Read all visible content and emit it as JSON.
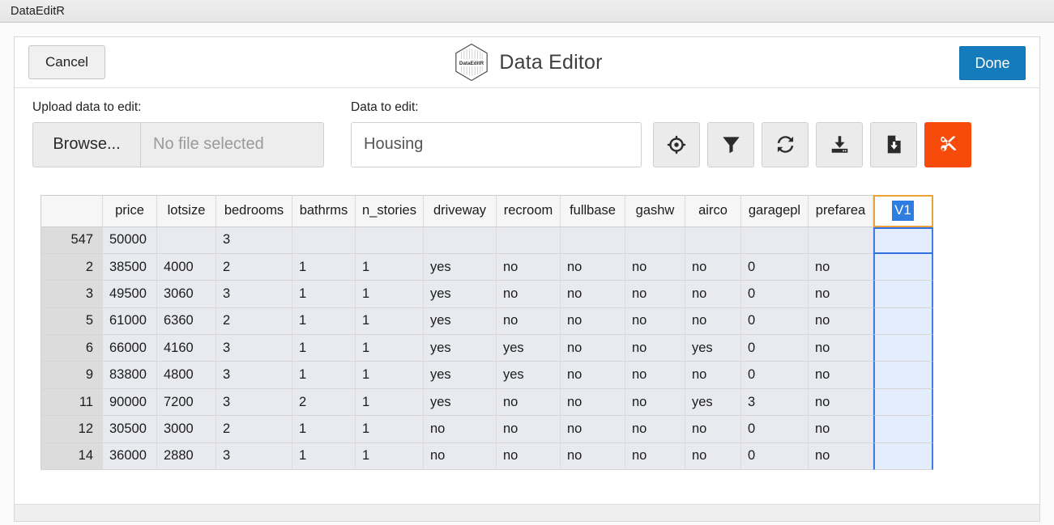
{
  "window": {
    "title": "DataEditR"
  },
  "header": {
    "cancel_label": "Cancel",
    "title": "Data Editor",
    "logo_text": "DataEditR",
    "done_label": "Done"
  },
  "controls": {
    "upload_label": "Upload data to edit:",
    "browse_label": "Browse...",
    "file_placeholder": "No file selected",
    "data_label": "Data to edit:",
    "data_value": "Housing",
    "tools": [
      {
        "name": "crosshairs-icon",
        "title": "select"
      },
      {
        "name": "filter-icon",
        "title": "filter"
      },
      {
        "name": "sync-icon",
        "title": "sync"
      },
      {
        "name": "download-icon",
        "title": "save"
      },
      {
        "name": "file-download-icon",
        "title": "export"
      },
      {
        "name": "scissors-icon",
        "title": "cut",
        "color": "#f74b0c"
      }
    ]
  },
  "table": {
    "columns": [
      "price",
      "lotsize",
      "bedrooms",
      "bathrms",
      "n_stories",
      "driveway",
      "recroom",
      "fullbase",
      "gashw",
      "airco",
      "garagepl",
      "prefarea"
    ],
    "editing_column": {
      "value": "V1",
      "selected": true
    },
    "rows": [
      {
        "id": "547",
        "cells": [
          "50000",
          "",
          "3",
          "",
          "",
          "",
          "",
          "",
          "",
          "",
          "",
          ""
        ],
        "extra": ""
      },
      {
        "id": "2",
        "cells": [
          "38500",
          "4000",
          "2",
          "1",
          "1",
          "yes",
          "no",
          "no",
          "no",
          "no",
          "0",
          "no"
        ],
        "extra": ""
      },
      {
        "id": "3",
        "cells": [
          "49500",
          "3060",
          "3",
          "1",
          "1",
          "yes",
          "no",
          "no",
          "no",
          "no",
          "0",
          "no"
        ],
        "extra": ""
      },
      {
        "id": "5",
        "cells": [
          "61000",
          "6360",
          "2",
          "1",
          "1",
          "yes",
          "no",
          "no",
          "no",
          "no",
          "0",
          "no"
        ],
        "extra": ""
      },
      {
        "id": "6",
        "cells": [
          "66000",
          "4160",
          "3",
          "1",
          "1",
          "yes",
          "yes",
          "no",
          "no",
          "yes",
          "0",
          "no"
        ],
        "extra": ""
      },
      {
        "id": "9",
        "cells": [
          "83800",
          "4800",
          "3",
          "1",
          "1",
          "yes",
          "yes",
          "no",
          "no",
          "no",
          "0",
          "no"
        ],
        "extra": ""
      },
      {
        "id": "11",
        "cells": [
          "90000",
          "7200",
          "3",
          "2",
          "1",
          "yes",
          "no",
          "no",
          "no",
          "yes",
          "3",
          "no"
        ],
        "extra": ""
      },
      {
        "id": "12",
        "cells": [
          "30500",
          "3000",
          "2",
          "1",
          "1",
          "no",
          "no",
          "no",
          "no",
          "no",
          "0",
          "no"
        ],
        "extra": ""
      },
      {
        "id": "14",
        "cells": [
          "36000",
          "2880",
          "3",
          "1",
          "1",
          "no",
          "no",
          "no",
          "no",
          "no",
          "0",
          "no"
        ],
        "extra": ""
      }
    ]
  },
  "colors": {
    "accent_done": "#147bbd",
    "accent_cut": "#f74b0c",
    "selection_blue": "#2f7de1",
    "edit_border_orange": "#e8a33d"
  }
}
